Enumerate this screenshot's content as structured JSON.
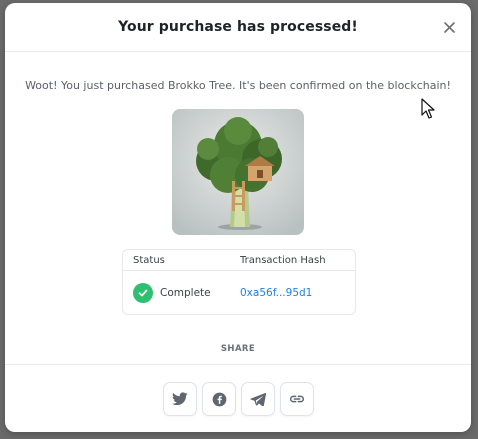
{
  "modal": {
    "title": "Your purchase has processed!",
    "message": "Woot! You just purchased Brokko Tree. It's been confirmed on the blockchain!"
  },
  "nft": {
    "name": "Brokko Tree",
    "image_alt": "Brokko Tree"
  },
  "transaction": {
    "status_header": "Status",
    "hash_header": "Transaction Hash",
    "status_value": "Complete",
    "hash_value": "0xa56f...95d1"
  },
  "share": {
    "label": "SHARE",
    "buttons": [
      {
        "icon": "twitter-icon"
      },
      {
        "icon": "facebook-icon"
      },
      {
        "icon": "telegram-icon"
      },
      {
        "icon": "link-icon"
      }
    ]
  },
  "colors": {
    "accent_link": "#2081e2",
    "success": "#2fbf71",
    "backdrop": "#6b6b6b"
  }
}
